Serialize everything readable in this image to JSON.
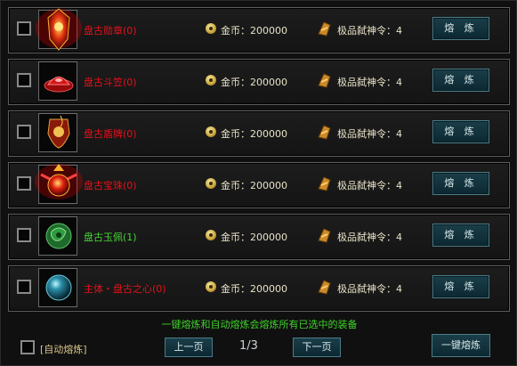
{
  "items": [
    {
      "name": "盘古勋章(0)",
      "name_color": "red",
      "gold_label": "金币：200000",
      "token_label": "极品弑神令：4",
      "button": "熔 炼",
      "icon": "medal-icon"
    },
    {
      "name": "盘古斗笠(0)",
      "name_color": "red",
      "gold_label": "金币：200000",
      "token_label": "极品弑神令：4",
      "button": "熔 炼",
      "icon": "hat-icon"
    },
    {
      "name": "盘古盾牌(0)",
      "name_color": "red",
      "gold_label": "金币：200000",
      "token_label": "极品弑神令：4",
      "button": "熔 炼",
      "icon": "shield-icon"
    },
    {
      "name": "盘古宝珠(0)",
      "name_color": "red",
      "gold_label": "金币：200000",
      "token_label": "极品弑神令：4",
      "button": "熔 炼",
      "icon": "orb-icon"
    },
    {
      "name": "盘古玉佩(1)",
      "name_color": "green",
      "gold_label": "金币：200000",
      "token_label": "极品弑神令：4",
      "button": "熔 炼",
      "icon": "jade-icon"
    },
    {
      "name": "主体・盘古之心(0)",
      "name_color": "red",
      "gold_label": "金币：200000",
      "token_label": "极品弑神令：4",
      "button": "熔 炼",
      "icon": "heart-orb-icon"
    }
  ],
  "notice": "一键熔炼和自动熔炼会熔炼所有已选中的装备",
  "auto_label": "[自动熔炼]",
  "prev_label": "上一页",
  "next_label": "下一页",
  "page_indicator": "1/3",
  "bulk_label": "一键熔炼",
  "colors": {
    "red_name": "#e8101a",
    "green_name": "#45d436",
    "notice": "#3fd12b"
  }
}
